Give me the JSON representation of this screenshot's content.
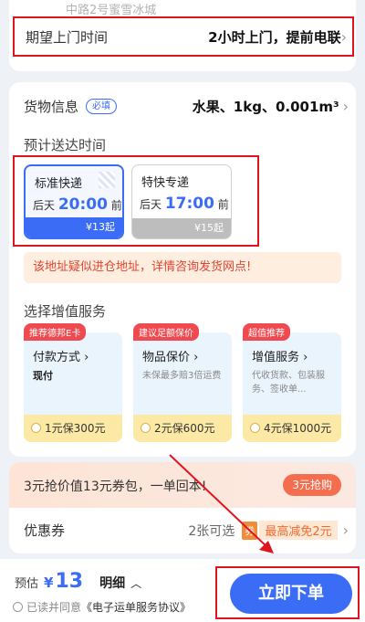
{
  "address": {
    "tail": "中路2号蜜雪冰城"
  },
  "pickup_time": {
    "label": "期望上门时间",
    "value": "2小时上门，提前电联"
  },
  "goods": {
    "label": "货物信息",
    "required": "必填",
    "value": "水果、1kg、0.001m³"
  },
  "delivery": {
    "title": "预计送达时间",
    "options": [
      {
        "name": "标准快递",
        "day": "后天",
        "time": "20:00",
        "suffix": "前",
        "price": "¥13起"
      },
      {
        "name": "特快专递",
        "day": "后天",
        "time": "17:00",
        "suffix": "前",
        "price": "¥15起"
      }
    ]
  },
  "warning": "该地址疑似进仓地址，详情咨询发货网点!",
  "value_added": {
    "title": "选择增值服务",
    "items": [
      {
        "tag": "推荐德邦E卡",
        "title": "付款方式",
        "sub": "现付",
        "price": "1元保300元"
      },
      {
        "tag": "建议足额保价",
        "title": "物品保价",
        "sub": "未保最多赔3倍运费",
        "price": "2元保600元"
      },
      {
        "tag": "超值推荐",
        "title": "增值服务",
        "sub": "代收货款、包装服务、签收单...",
        "price": "4元保1000元"
      }
    ]
  },
  "promo": {
    "text": "3元抢价值13元券包，一单回本!",
    "button": "3元抢购"
  },
  "coupon": {
    "label": "优惠券",
    "available": "2张可选",
    "ticket_icon": "券",
    "discount": "最高减免2元"
  },
  "bottom": {
    "estimate_label": "预估",
    "currency": "¥",
    "amount": "13",
    "detail": "明细",
    "agree_prefix": "已读并同意",
    "agree_link": "《电子运单服务协议》",
    "submit": "立即下单"
  },
  "colors": {
    "accent": "#3b6cf6",
    "highlight": "#e0141e",
    "warning": "#e2432f"
  }
}
